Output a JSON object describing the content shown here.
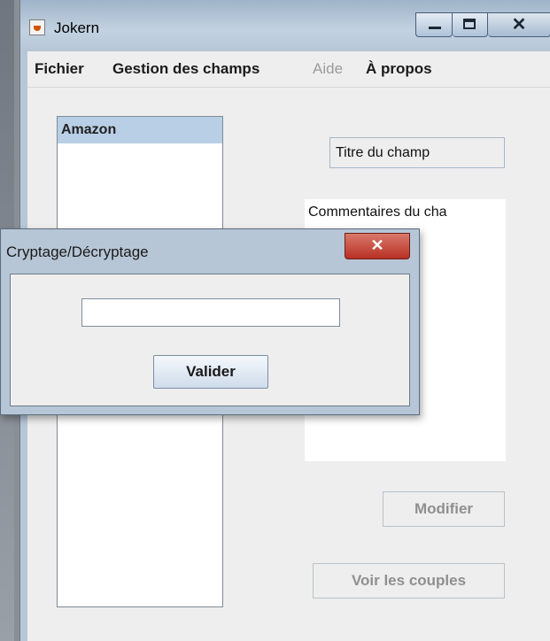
{
  "window": {
    "title": "Jokern",
    "minimize_glyph": "",
    "close_glyph": "✕"
  },
  "menu": {
    "items": [
      {
        "label": "Fichier",
        "enabled": true
      },
      {
        "label": "Gestion des champs",
        "enabled": true
      },
      {
        "label": "Aide",
        "enabled": false
      },
      {
        "label": "À propos",
        "enabled": true
      }
    ]
  },
  "list": {
    "items": [
      "Amazon"
    ],
    "selected_index": 0
  },
  "field": {
    "title_value": "Titre du champ",
    "comments_value": "Commentaires du cha"
  },
  "buttons": {
    "modify_label": "Modifier",
    "view_pairs_label": "Voir les couples"
  },
  "dialog": {
    "title": "Cryptage/Décryptage",
    "close_glyph": "✕",
    "input_value": "",
    "submit_label": "Valider"
  },
  "colors": {
    "title_bar": "#b7c7d8",
    "selection": "#b8cfe5",
    "close_red": "#c0392b"
  }
}
